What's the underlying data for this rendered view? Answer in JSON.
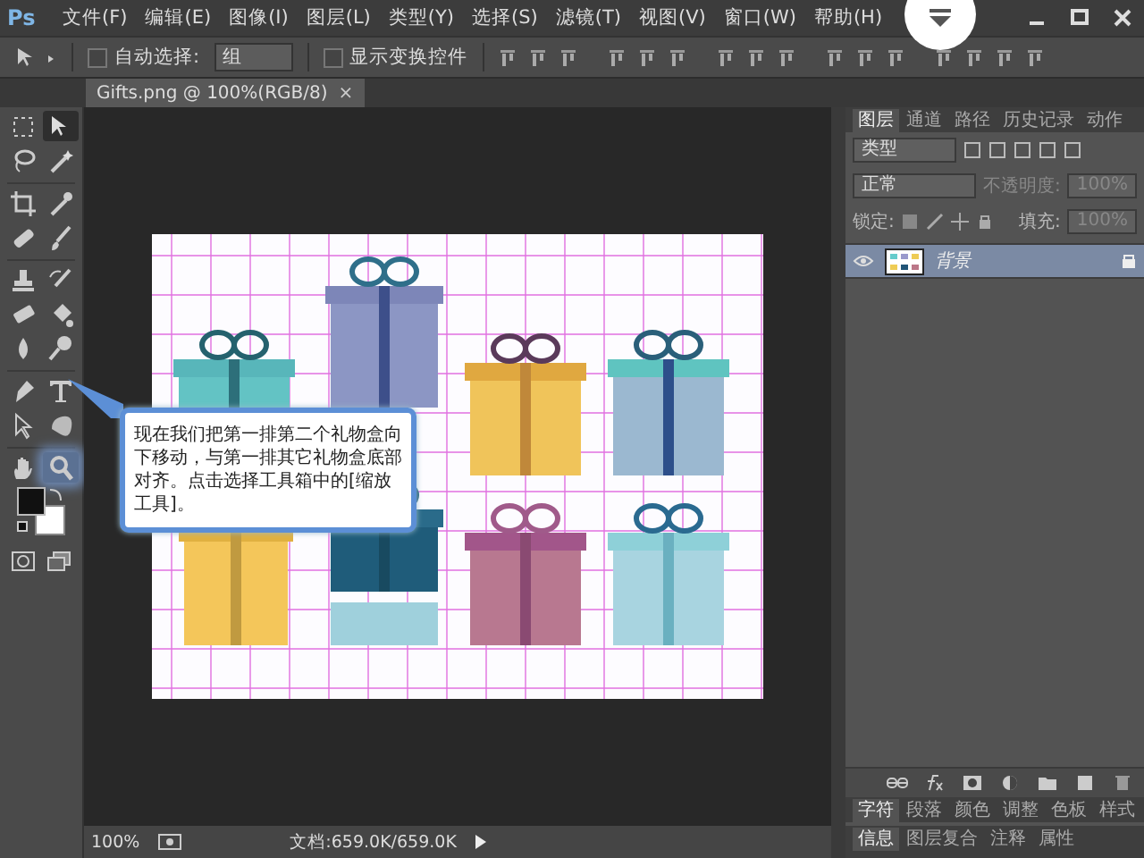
{
  "app": {
    "logo": "Ps"
  },
  "menu": [
    "文件(F)",
    "编辑(E)",
    "图像(I)",
    "图层(L)",
    "类型(Y)",
    "选择(S)",
    "滤镜(T)",
    "视图(V)",
    "窗口(W)",
    "帮助(H)"
  ],
  "options": {
    "auto_select": {
      "label": "自动选择:",
      "checked": false,
      "value": "组"
    },
    "show_transform": {
      "label": "显示变换控件",
      "checked": false
    }
  },
  "document_tab": {
    "title": "Gifts.png @ 100%(RGB/8)",
    "close": "×"
  },
  "tools": [
    {
      "selected": false,
      "spotlight": false
    },
    {
      "selected": true,
      "spotlight": false
    },
    {
      "selected": false,
      "spotlight": false
    },
    {
      "selected": false,
      "spotlight": false
    },
    {
      "selected": false,
      "spotlight": false
    },
    {
      "selected": false,
      "spotlight": false
    },
    {
      "selected": false,
      "spotlight": false
    },
    {
      "selected": false,
      "spotlight": false
    },
    {
      "selected": false,
      "spotlight": false
    },
    {
      "selected": false,
      "spotlight": false
    },
    {
      "selected": false,
      "spotlight": false
    },
    {
      "selected": false,
      "spotlight": false
    },
    {
      "selected": false,
      "spotlight": false
    },
    {
      "selected": false,
      "spotlight": false
    },
    {
      "selected": false,
      "spotlight": false
    },
    {
      "selected": false,
      "spotlight": false
    },
    {
      "selected": false,
      "spotlight": false
    },
    {
      "selected": false,
      "spotlight": false
    },
    {
      "selected": false,
      "spotlight": false
    },
    {
      "selected": false,
      "spotlight": true
    }
  ],
  "callout": {
    "text": "现在我们把第一排第二个礼物盒向下移动，与第一排其它礼物盒底部对齐。点击选择工具箱中的[缩放工具]。"
  },
  "panel_tabs": [
    {
      "label": "图层",
      "selected": true
    },
    {
      "label": "通道",
      "selected": false
    },
    {
      "label": "路径",
      "selected": false
    },
    {
      "label": "历史记录",
      "selected": false
    },
    {
      "label": "动作",
      "selected": false
    }
  ],
  "layers_panel": {
    "filter": "类型",
    "blend": "正常",
    "opacity_label": "不透明度:",
    "opacity": "100%",
    "lock_label": "锁定:",
    "fill_label": "填充:",
    "fill": "100%",
    "layers": [
      {
        "name": "背景",
        "visible": true,
        "selected": true,
        "locked": true
      }
    ]
  },
  "bottom_tabs_1": [
    {
      "label": "字符",
      "selected": true
    },
    {
      "label": "段落",
      "selected": false
    },
    {
      "label": "颜色",
      "selected": false
    },
    {
      "label": "调整",
      "selected": false
    },
    {
      "label": "色板",
      "selected": false
    },
    {
      "label": "样式",
      "selected": false
    }
  ],
  "bottom_tabs_2": [
    {
      "label": "信息",
      "selected": true
    },
    {
      "label": "图层复合",
      "selected": false
    },
    {
      "label": "注释",
      "selected": false
    },
    {
      "label": "属性",
      "selected": false
    }
  ],
  "status": {
    "zoom": "100%",
    "document": "文档:659.0K/659.0K"
  }
}
